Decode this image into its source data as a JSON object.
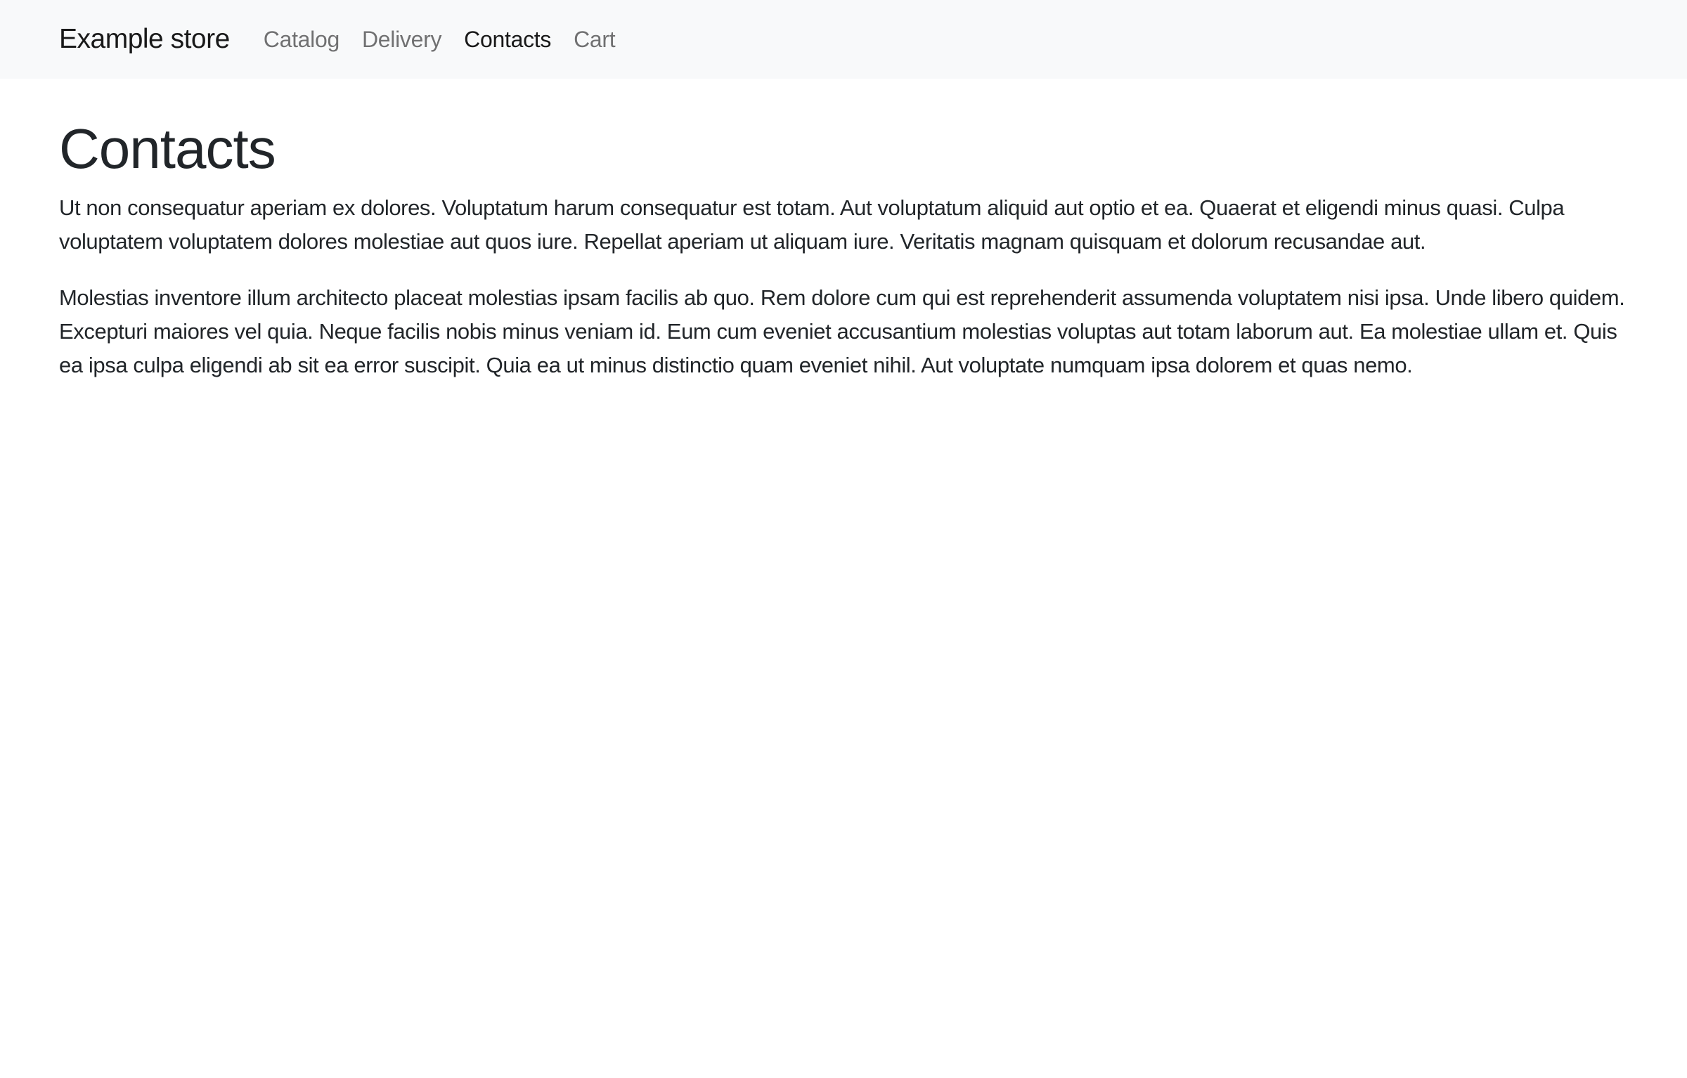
{
  "navbar": {
    "brand": "Example store",
    "links": [
      {
        "label": "Catalog",
        "active": false
      },
      {
        "label": "Delivery",
        "active": false
      },
      {
        "label": "Contacts",
        "active": true
      },
      {
        "label": "Cart",
        "active": false
      }
    ]
  },
  "main": {
    "title": "Contacts",
    "paragraphs": [
      "Ut non consequatur aperiam ex dolores. Voluptatum harum consequatur est totam. Aut voluptatum aliquid aut optio et ea. Quaerat et eligendi minus quasi. Culpa voluptatem voluptatem dolores molestiae aut quos iure. Repellat aperiam ut aliquam iure. Veritatis magnam quisquam et dolorum recusandae aut.",
      "Molestias inventore illum architecto placeat molestias ipsam facilis ab quo. Rem dolore cum qui est reprehenderit assumenda voluptatem nisi ipsa. Unde libero quidem. Excepturi maiores vel quia. Neque facilis nobis minus veniam id. Eum cum eveniet accusantium molestias voluptas aut totam laborum aut. Ea molestiae ullam et. Quis ea ipsa culpa eligendi ab sit ea error suscipit. Quia ea ut minus distinctio quam eveniet nihil. Aut voluptate numquam ipsa dolorem et quas nemo."
    ]
  }
}
